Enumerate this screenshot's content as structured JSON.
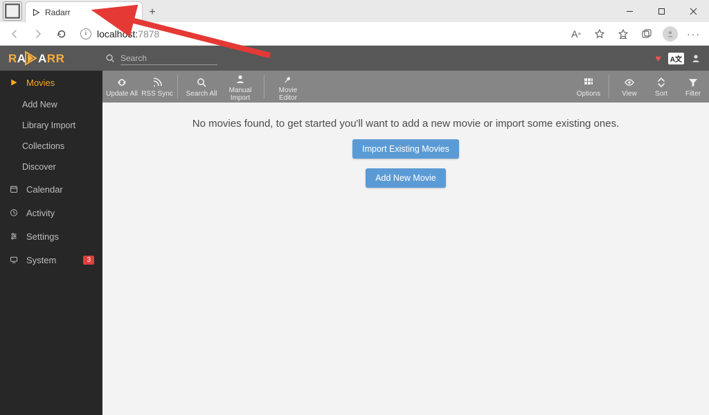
{
  "browser": {
    "tab_title": "Radarr",
    "url_host": "localhost:",
    "url_port": "7878"
  },
  "app_header": {
    "search_placeholder": "Search"
  },
  "sidebar": {
    "movies": "Movies",
    "add_new": "Add New",
    "library_import": "Library Import",
    "collections": "Collections",
    "discover": "Discover",
    "calendar": "Calendar",
    "activity": "Activity",
    "settings": "Settings",
    "system": "System",
    "system_badge": "3"
  },
  "toolbar": {
    "update_all": "Update All",
    "rss_sync": "RSS Sync",
    "search_all": "Search All",
    "manual_import": "Manual Import",
    "movie_editor": "Movie Editor",
    "options": "Options",
    "view": "View",
    "sort": "Sort",
    "filter": "Filter"
  },
  "content": {
    "empty_message": "No movies found, to get started you'll want to add a new movie or import some existing ones.",
    "import_button": "Import Existing Movies",
    "add_button": "Add New Movie"
  },
  "lang_badge": "A文"
}
